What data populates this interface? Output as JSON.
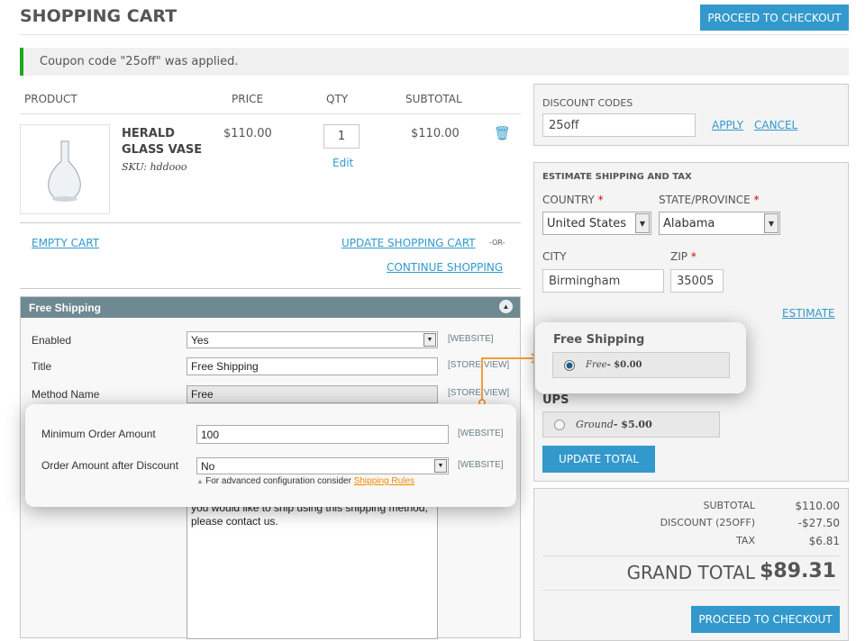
{
  "header": {
    "title": "SHOPPING CART",
    "checkout_label": "PROCEED TO CHECKOUT"
  },
  "message": "Coupon code \"25off\" was applied.",
  "table": {
    "headers": [
      "PRODUCT",
      "PRICE",
      "QTY",
      "SUBTOTAL"
    ],
    "item": {
      "name_line1": "HERALD",
      "name_line2": "GLASS VASE",
      "sku": "SKU: hddooo",
      "price": "$110.00",
      "qty": "1",
      "edit": "Edit",
      "subtotal": "$110.00"
    }
  },
  "actions": {
    "empty": "EMPTY CART",
    "update": "UPDATE SHOPPING CART",
    "or": "-OR-",
    "continue": "CONTINUE SHOPPING"
  },
  "admin": {
    "title": "Free Shipping",
    "rows": [
      {
        "label": "Enabled",
        "value": "Yes",
        "scope": "[WEBSITE]"
      },
      {
        "label": "Title",
        "value": "Free Shipping",
        "scope": "[STORE VIEW]"
      },
      {
        "label": "Method Name",
        "value": "Free",
        "scope": "[STORE VIEW]"
      }
    ],
    "textarea": "you would like to ship using this shipping method, please contact us.",
    "overlay": [
      {
        "label": "Minimum Order Amount",
        "value": "100",
        "scope": "[WEBSITE]"
      },
      {
        "label": "Order Amount after Discount",
        "value": "No",
        "scope": "[WEBSITE]"
      }
    ],
    "hint": "For advanced configuration consider",
    "hint_link": "Shipping Rules"
  },
  "discount": {
    "title": "DISCOUNT CODES",
    "value": "25off",
    "apply": "APPLY",
    "cancel": "CANCEL"
  },
  "shipping": {
    "title": "ESTIMATE SHIPPING AND TAX",
    "country_label": "COUNTRY",
    "country": "United States",
    "state_label": "STATE/PROVINCE",
    "state": "Alabama",
    "city_label": "CITY",
    "city": "Birmingham",
    "zip_label": "ZIP",
    "zip": "35005",
    "estimate": "ESTIMATE",
    "required": "*",
    "free_title": "Free Shipping",
    "free_method": "Free",
    "free_price": " - $0.00",
    "ups_title": "UPS",
    "ups_method": "Ground",
    "ups_price": " - $5.00",
    "update_total": "UPDATE TOTAL"
  },
  "totals": {
    "subtotal_label": "SUBTOTAL",
    "subtotal": "$110.00",
    "discount_label": "DISCOUNT (25OFF)",
    "discount": "-$27.50",
    "tax_label": "TAX",
    "tax": "$6.81",
    "grand_label": "GRAND TOTAL",
    "grand": "$89.31",
    "checkout": "PROCEED TO CHECKOUT"
  },
  "colors": {
    "accent": "#3399cc",
    "admin_header": "#6f8992",
    "highlight": "#f39c3a",
    "success": "#1aa81a"
  }
}
